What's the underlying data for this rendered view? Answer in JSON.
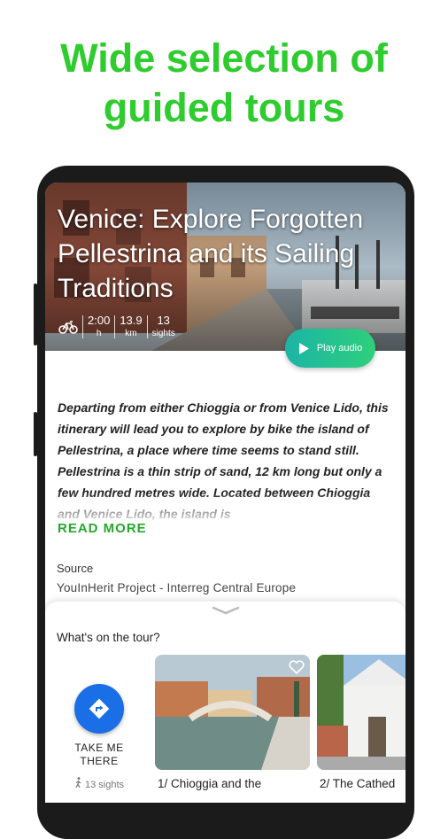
{
  "promo": {
    "line1": "Wide selection of",
    "line2": "guided tours"
  },
  "tour": {
    "title": "Venice: Explore Forgotten Pellestrina and its Sailing Traditions",
    "mode_icon": "bicycle-icon",
    "duration": {
      "value": "2:00",
      "unit": "h"
    },
    "distance": {
      "value": "13.9",
      "unit": "km"
    },
    "sights": {
      "value": "13",
      "unit": "sights"
    },
    "play_audio_label": "Play audio",
    "description": "Departing from either Chioggia or from Venice Lido, this itinerary will lead you to explore by bike the island of Pellestrina, a place where time seems to stand still. Pellestrina is a thin strip of sand, 12 km long but only a few hundred metres wide. Located between Chioggia and Venice Lido, the island is",
    "read_more": "READ MORE",
    "source_label": "Source",
    "source_value": "YouInHerit Project - Interreg Central Europe"
  },
  "sheet": {
    "heading": "What's on the tour?",
    "take_me_there": "TAKE ME THERE",
    "sights_count": "13 sights",
    "sights": [
      {
        "caption": "1/ Chioggia and the"
      },
      {
        "caption": "2/ The Cathed"
      }
    ]
  },
  "colors": {
    "promo_green": "#2ecc2e",
    "read_more_green": "#24a82b",
    "nav_blue": "#1a6ee6",
    "play_gradient_start": "#1cb4a6",
    "play_gradient_end": "#2ed07b"
  }
}
